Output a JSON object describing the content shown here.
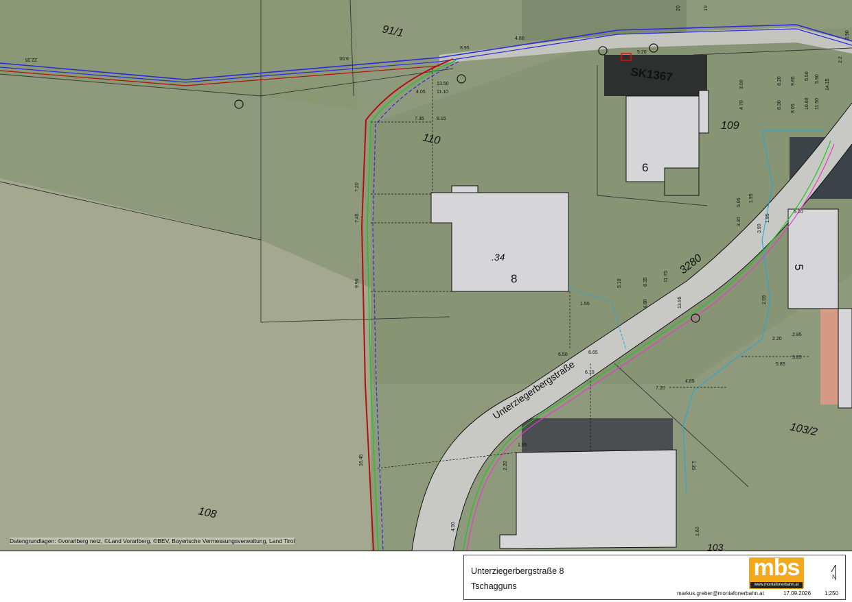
{
  "map": {
    "parcels": [
      "91/1",
      "110",
      "109",
      "108",
      "103/2",
      "3280",
      "10",
      "103"
    ],
    "building_numbers": [
      "6",
      "8",
      "5"
    ],
    "parcel_small": ".34",
    "station_label": "SK1367",
    "street_name": "Unterziegerbergstraße",
    "dimensions": {
      "d22_35": "22.35",
      "d9_55": "9.55",
      "d8_95": "8.95",
      "d4_80": "4.80",
      "d5_20": "5.20",
      "d13_50": "13.50",
      "d4_05": "4.05",
      "d11_10": "11.10",
      "d7_35": "7.35",
      "d8_15": "8.15",
      "d7_20a": "7.20",
      "d7_45": "7.45",
      "d9_90": "9.90",
      "d1_55": "1.55",
      "d6_50": "6.50",
      "d6_65": "6.65",
      "d5_10": "5.10",
      "d8_35": "8.35",
      "d4_80b": "4.80",
      "d11_75": "11.75",
      "d13_95": "13.95",
      "d5_10b": "5.10",
      "d6_10": "6.10",
      "d7_20b": "7.20",
      "d4_85": "4.85",
      "d1_95": "1.95",
      "d2_20": "2.20",
      "d16_45": "16.45",
      "d4_00": "4.00",
      "d1_35": "1.35",
      "d1_60": "1.60",
      "d2_05": "2.05",
      "d2_20b": "2.20",
      "d2_85": "2.85",
      "d5_85": "5.85",
      "d5_85b": "5.85",
      "d3_00": "3.00",
      "d4_70": "4.70",
      "d8_20": "8.20",
      "d8_30": "8.30",
      "d9_65": "9.65",
      "d8_05": "8.05",
      "d5_50": "5.50",
      "d10_80": "10.80",
      "d5_90": "5.90",
      "d11_50": "11.50",
      "d14_15": "14.15",
      "d3_90": "3.90",
      "d5_05": "5.05",
      "d1_95b": "1.95",
      "d3_30": "3.30",
      "d3_90b": "3.90",
      "d1_85": "1.85",
      "d2_2": "2.2",
      "d20": "20"
    },
    "attribution": "Datengrundlagen: ©vorarlberg netz, ©Land Vorarlberg, ©BEV, Bayerische Vermessungsverwaltung, Land Tirol"
  },
  "titlebox": {
    "address_line1": "Unterziegerbergstraße 8",
    "address_line2": "Tschagguns",
    "logo_text": "mbs",
    "logo_url": "www.montafonerbahn.at",
    "email": "markus.greber@montafonerbahn.at",
    "date": "17.09.2026",
    "scale": "1:250",
    "north_label": "N"
  },
  "colors": {
    "meadow": "#8f9a7c",
    "meadow_light": "#a3a88e",
    "road": "#c8c8c4",
    "building": "#d6d6d8",
    "gas_red": "#b01010",
    "electric_blue": "#2a2ad8",
    "comm_green": "#22c422",
    "water_cyan": "#18a8e8",
    "pink": "#e040c0",
    "logo_orange": "#f4a81c"
  }
}
